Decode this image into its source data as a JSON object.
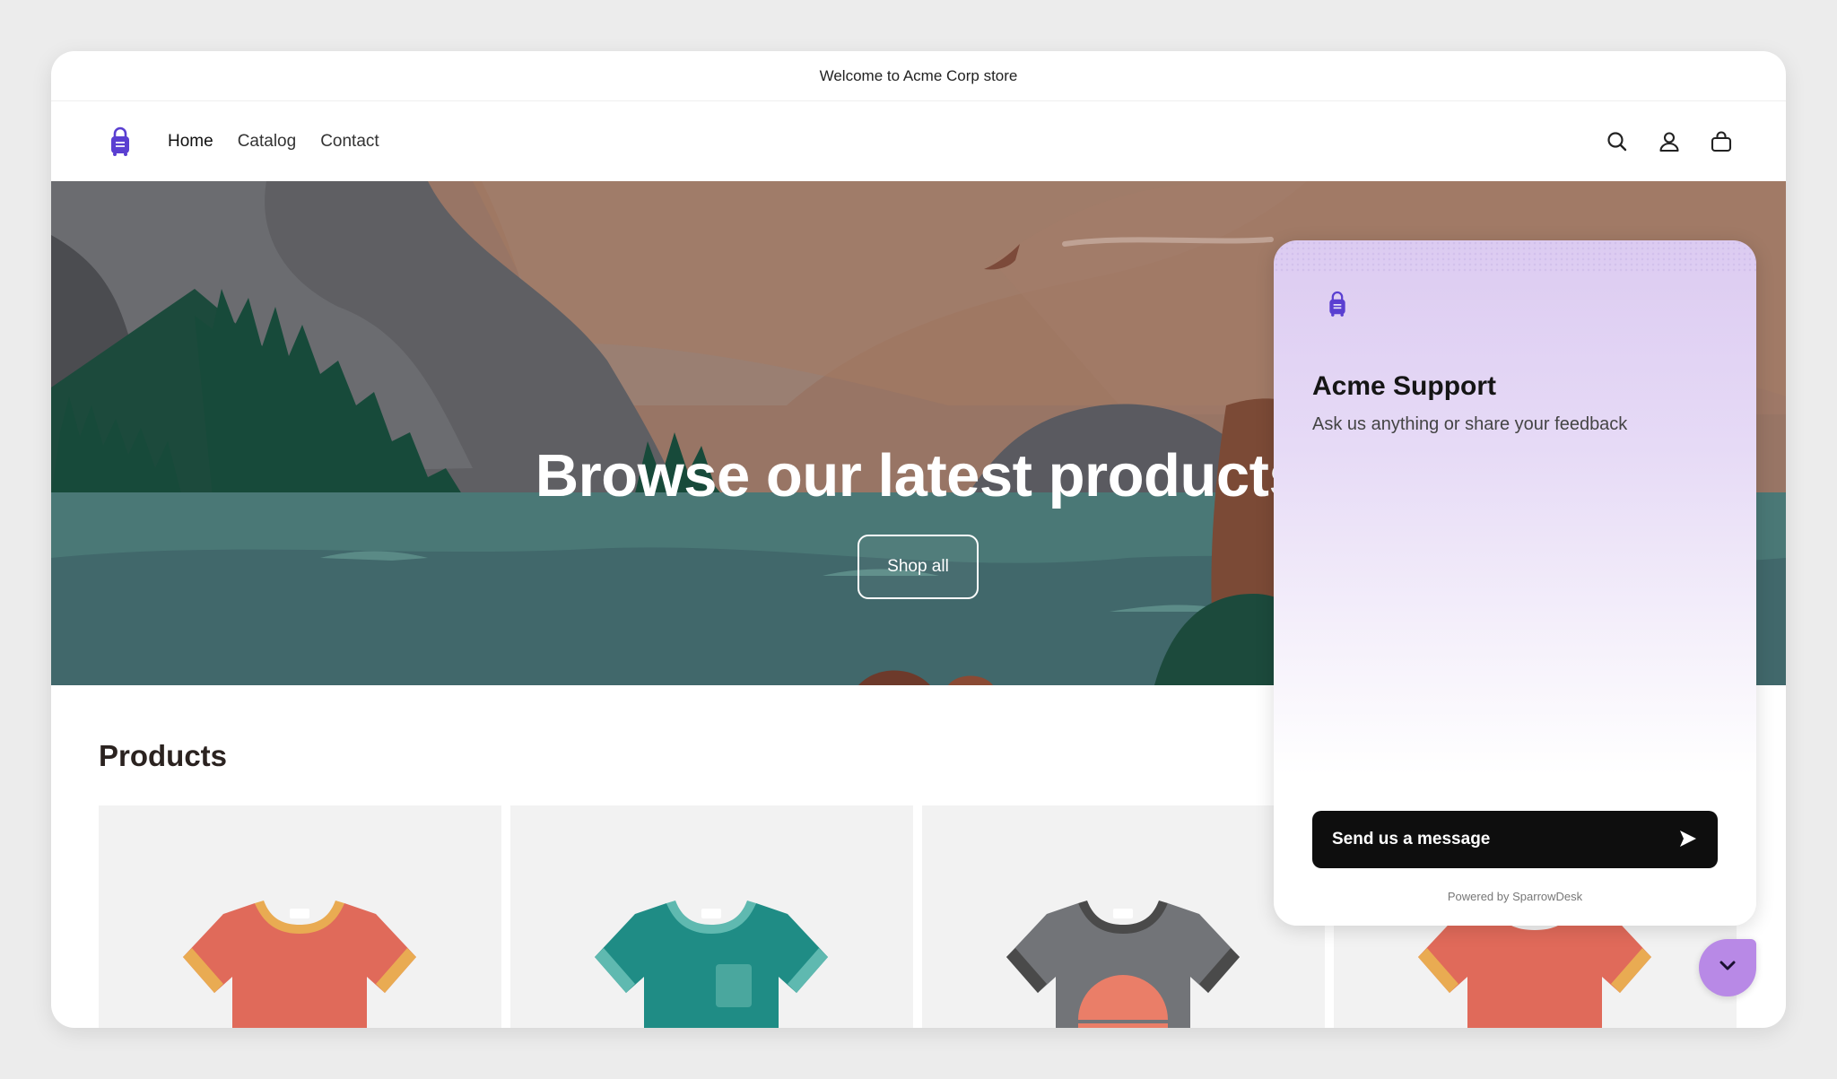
{
  "announcement": "Welcome to Acme Corp store",
  "nav": {
    "items": [
      {
        "label": "Home"
      },
      {
        "label": "Catalog"
      },
      {
        "label": "Contact"
      }
    ]
  },
  "icons": {
    "logo": "shopping-bag-logo-icon",
    "search": "search-icon",
    "account": "user-icon",
    "cart": "cart-bag-icon",
    "send": "send-arrow-icon",
    "collapse": "chevron-down-icon"
  },
  "hero": {
    "title": "Browse our latest products",
    "button": "Shop all"
  },
  "products": {
    "title": "Products",
    "items": [
      {
        "color": "#e06a5a",
        "trim": "#e9ab52"
      },
      {
        "color": "#1f8c85",
        "trim": "#5fb9b0"
      },
      {
        "color": "#727478",
        "trim": "#4a4a4a"
      },
      {
        "color": "#e06a5a",
        "trim": "#e9ab52"
      }
    ]
  },
  "chat": {
    "title": "Acme Support",
    "subtitle": "Ask us anything or share your feedback",
    "send_label": "Send us a message",
    "powered": "Powered by SparrowDesk"
  },
  "colors": {
    "brand": "#5a3fd1",
    "chat_accent": "#b889e6"
  }
}
